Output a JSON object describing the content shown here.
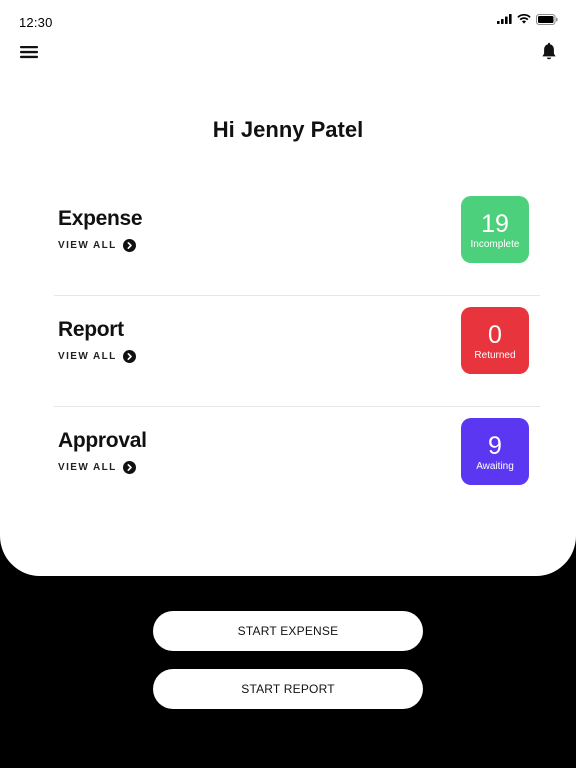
{
  "status_bar": {
    "time": "12:30",
    "icons": [
      "signal-icon",
      "wifi-icon",
      "battery-icon"
    ]
  },
  "header": {
    "menu_icon": "hamburger-menu-icon",
    "notification_icon": "bell-icon"
  },
  "greeting": "Hi Jenny Patel",
  "summary": [
    {
      "title": "Expense",
      "link_label": "VIEW ALL",
      "count": "19",
      "status": "Incomplete",
      "color": "#4cd07c"
    },
    {
      "title": "Report",
      "link_label": "VIEW ALL",
      "count": "0",
      "status": "Returned",
      "color": "#e8343c"
    },
    {
      "title": "Approval",
      "link_label": "VIEW ALL",
      "count": "9",
      "status": "Awaiting",
      "color": "#5b37f2"
    }
  ],
  "actions": {
    "start_expense": "START EXPENSE",
    "start_report": "START REPORT"
  },
  "colors": {
    "background": "#000000",
    "card": "#ffffff",
    "text": "#111111"
  }
}
